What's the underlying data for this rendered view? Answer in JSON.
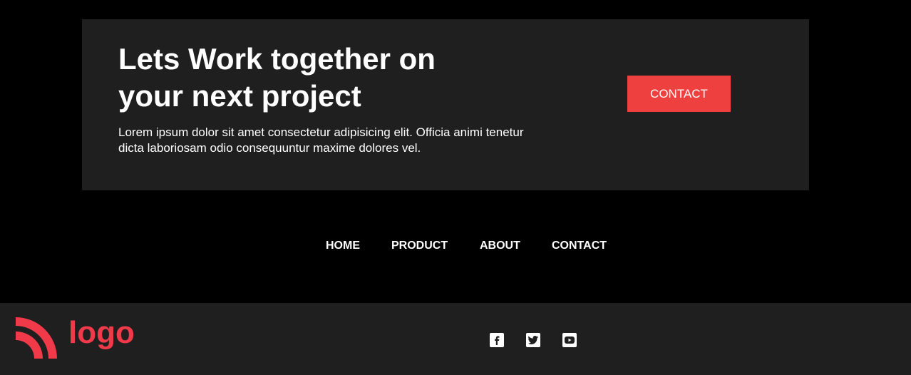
{
  "cta": {
    "title_line1": "Lets Work together on",
    "title_line2": "your next project",
    "text_line1": "Lorem ipsum dolor sit amet consectetur adipisicing elit. Officia animi tenetur",
    "text_line2": "dicta laboriosam odio consequuntur maxime dolores vel.",
    "button_label": "CONTACT"
  },
  "nav": {
    "items": [
      {
        "label": "HOME"
      },
      {
        "label": "PRODUCT"
      },
      {
        "label": "ABOUT"
      },
      {
        "label": "CONTACT"
      }
    ]
  },
  "footer": {
    "logo_text": "logo",
    "social_icons": [
      "facebook-icon",
      "twitter-icon",
      "youtube-icon"
    ]
  },
  "colors": {
    "background": "#000000",
    "panel": "#1f1f1f",
    "accent": "#ef4040",
    "logo": "#f03a4a",
    "text": "#ffffff"
  }
}
